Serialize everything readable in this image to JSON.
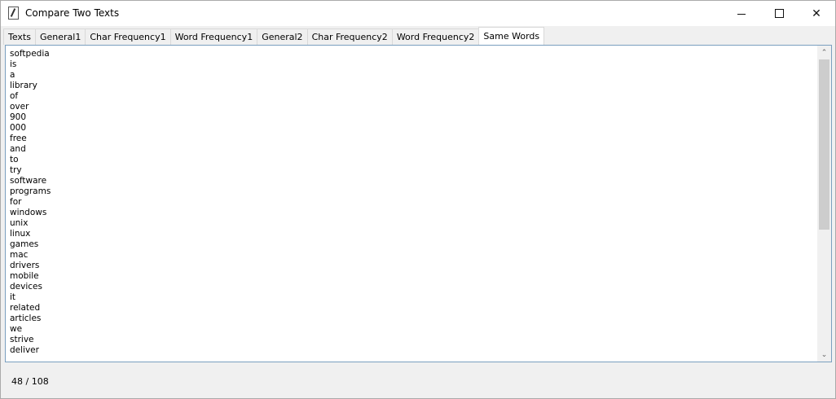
{
  "window": {
    "title": "Compare Two Texts",
    "controls": {
      "minimize": "–",
      "maximize": "☐",
      "close": "✕"
    }
  },
  "tabs": [
    {
      "label": "Texts",
      "active": false
    },
    {
      "label": "General1",
      "active": false
    },
    {
      "label": "Char Frequency1",
      "active": false
    },
    {
      "label": "Word Frequency1",
      "active": false
    },
    {
      "label": "General2",
      "active": false
    },
    {
      "label": "Char Frequency2",
      "active": false
    },
    {
      "label": "Word Frequency2",
      "active": false
    },
    {
      "label": "Same Words",
      "active": true
    }
  ],
  "words": [
    "softpedia",
    "is",
    "a",
    "library",
    "of",
    "over",
    "900",
    "000",
    "free",
    "and",
    "to",
    "try",
    "software",
    "programs",
    "for",
    "windows",
    "unix",
    "linux",
    "games",
    "mac",
    "drivers",
    "mobile",
    "devices",
    "it",
    "related",
    "articles",
    "we",
    "strive",
    "deliver"
  ],
  "scroll_icons": {
    "up": "chevron-up",
    "down": "chevron-down"
  },
  "status": {
    "counter": "48 / 108"
  }
}
